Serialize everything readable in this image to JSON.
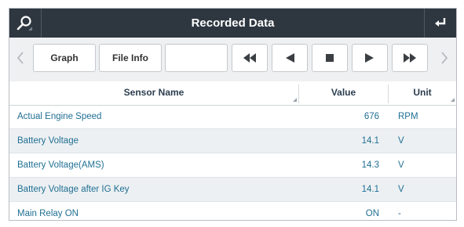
{
  "window": {
    "title": "Recorded Data"
  },
  "toolbar": {
    "graph_label": "Graph",
    "fileinfo_label": "File Info",
    "blank_label": ""
  },
  "table": {
    "headers": [
      "Sensor Name",
      "Value",
      "Unit"
    ],
    "rows": [
      {
        "name": "Actual Engine Speed",
        "value": "676",
        "unit": "RPM"
      },
      {
        "name": "Battery Voltage",
        "value": "14.1",
        "unit": "V"
      },
      {
        "name": "Battery Voltage(AMS)",
        "value": "14.3",
        "unit": "V"
      },
      {
        "name": "Battery Voltage after IG Key",
        "value": "14.1",
        "unit": "V"
      },
      {
        "name": "Main Relay ON",
        "value": "ON",
        "unit": "-"
      }
    ]
  },
  "colors": {
    "titlebar": "#2e3740",
    "row_text": "#1f6f94",
    "alt_row": "#edf0f2"
  },
  "icons": [
    "search-icon",
    "return-icon",
    "chevron-left-icon",
    "chevron-right-icon",
    "rewind-icon",
    "play-reverse-icon",
    "stop-icon",
    "play-icon",
    "fast-forward-icon"
  ]
}
